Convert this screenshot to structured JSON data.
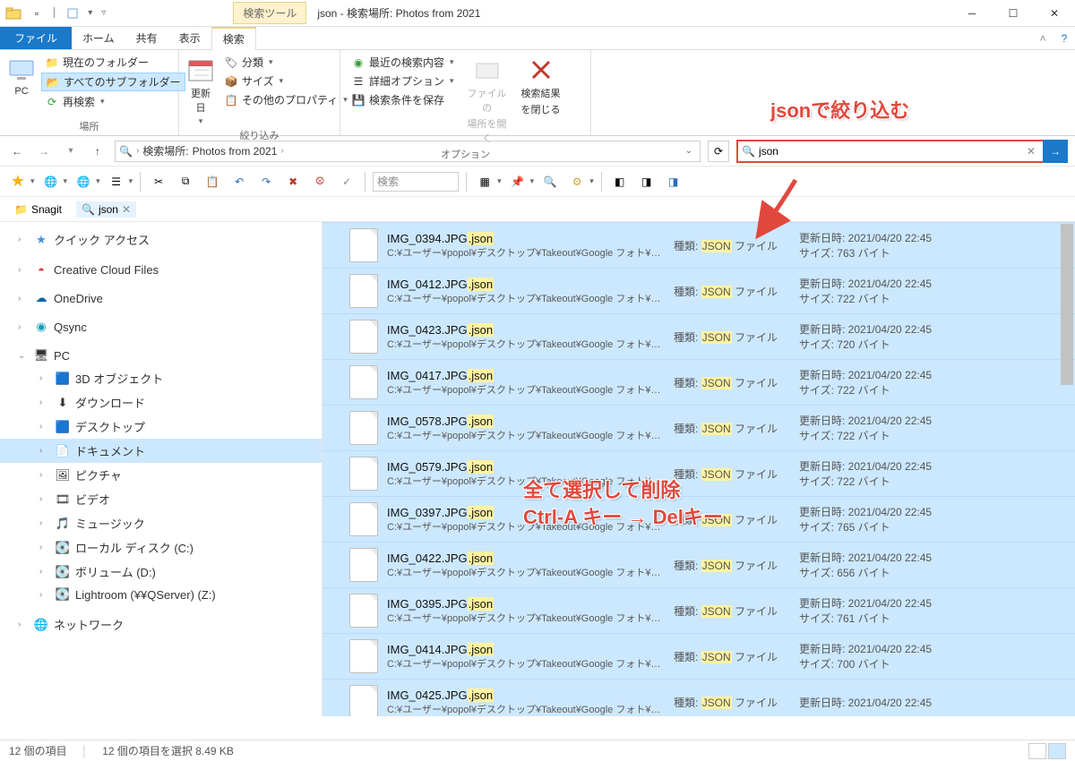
{
  "window": {
    "context_tab": "検索ツール",
    "title": "json - 検索場所: Photos from 2021"
  },
  "tabs": {
    "file": "ファイル",
    "home": "ホーム",
    "share": "共有",
    "view": "表示",
    "search": "検索"
  },
  "ribbon": {
    "location": {
      "pc": "PC",
      "current_folder": "現在のフォルダー",
      "all_subfolders": "すべてのサブフォルダー",
      "search_again": "再検索",
      "group": "場所"
    },
    "refine": {
      "date": "更新日",
      "kind": "分類",
      "size": "サイズ",
      "other": "その他のプロパティ",
      "group": "絞り込み"
    },
    "options": {
      "recent": "最近の検索内容",
      "advanced": "詳細オプション",
      "save": "検索条件を保存",
      "open_loc_l1": "ファイルの",
      "open_loc_l2": "場所を開く",
      "close_l1": "検索結果",
      "close_l2": "を閉じる",
      "group": "オプション"
    }
  },
  "breadcrumb": {
    "prefix": "検索場所:",
    "location": "Photos from 2021"
  },
  "toolbar2_search_placeholder": "検索",
  "search": {
    "value": "json"
  },
  "favbar": {
    "snagit": "Snagit",
    "json": "json"
  },
  "sidebar": {
    "quick_access": "クイック アクセス",
    "ccf": "Creative Cloud Files",
    "onedrive": "OneDrive",
    "qsync": "Qsync",
    "pc": "PC",
    "pc_children": [
      "3D オブジェクト",
      "ダウンロード",
      "デスクトップ",
      "ドキュメント",
      "ピクチャ",
      "ビデオ",
      "ミュージック",
      "ローカル ディスク (C:)",
      "ボリューム (D:)",
      "Lightroom (¥¥QServer) (Z:)"
    ],
    "network": "ネットワーク"
  },
  "files": {
    "path": "C:¥ユーザー¥popol¥デスクトップ¥Takeout¥Google フォト¥…",
    "type_label_pre": "種類:",
    "type_value": "JSON",
    "type_label_post": "ファイル",
    "date_label": "更新日時:",
    "date_value": "2021/04/20 22:45",
    "size_label": "サイズ:",
    "size_unit": "バイト",
    "rows": [
      {
        "base": "IMG_0394.JPG",
        "ext": ".json",
        "size": "763"
      },
      {
        "base": "IMG_0412.JPG",
        "ext": ".json",
        "size": "722"
      },
      {
        "base": "IMG_0423.JPG",
        "ext": ".json",
        "size": "720"
      },
      {
        "base": "IMG_0417.JPG",
        "ext": ".json",
        "size": "722"
      },
      {
        "base": "IMG_0578.JPG",
        "ext": ".json",
        "size": "722"
      },
      {
        "base": "IMG_0579.JPG",
        "ext": ".json",
        "size": "722"
      },
      {
        "base": "IMG_0397.JPG",
        "ext": ".json",
        "size": "765"
      },
      {
        "base": "IMG_0422.JPG",
        "ext": ".json",
        "size": "656"
      },
      {
        "base": "IMG_0395.JPG",
        "ext": ".json",
        "size": "761"
      },
      {
        "base": "IMG_0414.JPG",
        "ext": ".json",
        "size": "700"
      },
      {
        "base": "IMG_0425.JPG",
        "ext": ".json",
        "size": ""
      }
    ]
  },
  "status": {
    "items": "12 個の項目",
    "selected": "12 個の項目を選択 8.49 KB"
  },
  "annotations": {
    "filter": "jsonで絞り込む",
    "delete_l1": "全て選択して削除",
    "delete_l2": "Ctrl-A キー  →  Delキー"
  }
}
